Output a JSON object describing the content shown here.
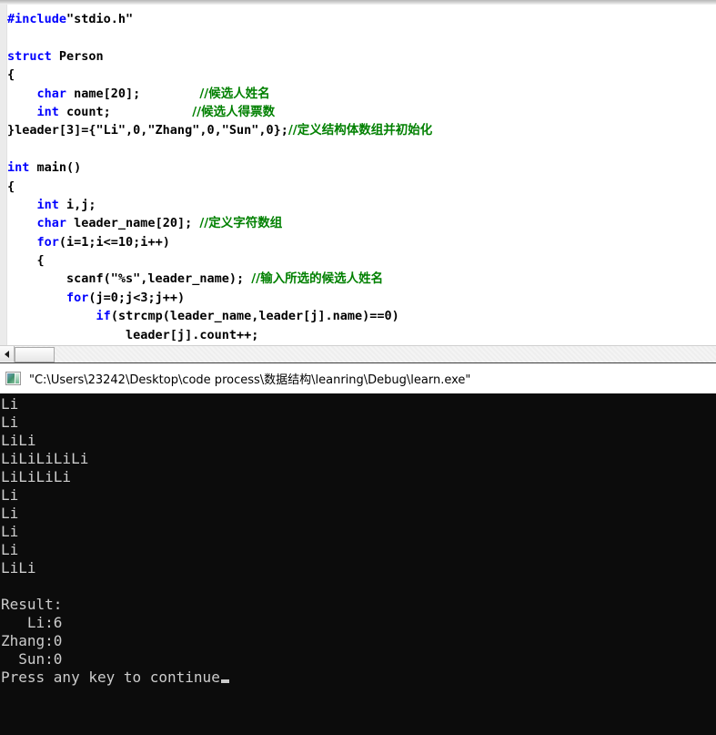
{
  "editor": {
    "name": "source-code-editor",
    "language": "C",
    "code_lines": [
      {
        "id": "l1",
        "segments": [
          {
            "t": "#include",
            "c": "pp"
          },
          {
            "t": "\"stdio.h\"",
            "c": "plain"
          }
        ]
      },
      {
        "id": "l2",
        "segments": []
      },
      {
        "id": "l3",
        "segments": [
          {
            "t": "struct",
            "c": "kw"
          },
          {
            "t": " Person",
            "c": "plain"
          }
        ]
      },
      {
        "id": "l4",
        "segments": [
          {
            "t": "{",
            "c": "plain"
          }
        ]
      },
      {
        "id": "l5",
        "segments": [
          {
            "t": "    ",
            "c": "plain"
          },
          {
            "t": "char",
            "c": "kw"
          },
          {
            "t": " name[20];        ",
            "c": "plain"
          },
          {
            "t": "//候选人姓名",
            "c": "cm"
          }
        ]
      },
      {
        "id": "l6",
        "segments": [
          {
            "t": "    ",
            "c": "plain"
          },
          {
            "t": "int",
            "c": "kw"
          },
          {
            "t": " count;           ",
            "c": "plain"
          },
          {
            "t": "//候选人得票数",
            "c": "cm"
          }
        ]
      },
      {
        "id": "l7",
        "segments": [
          {
            "t": "}leader[3]={\"Li\",0,\"Zhang\",0,\"Sun\",0};",
            "c": "plain"
          },
          {
            "t": "//定义结构体数组并初始化",
            "c": "cm"
          }
        ]
      },
      {
        "id": "l8",
        "segments": []
      },
      {
        "id": "l9",
        "segments": [
          {
            "t": "int",
            "c": "kw"
          },
          {
            "t": " main()",
            "c": "plain"
          }
        ]
      },
      {
        "id": "l10",
        "segments": [
          {
            "t": "{",
            "c": "plain"
          }
        ]
      },
      {
        "id": "l11",
        "segments": [
          {
            "t": "    ",
            "c": "plain"
          },
          {
            "t": "int",
            "c": "kw"
          },
          {
            "t": " i,j;",
            "c": "plain"
          }
        ]
      },
      {
        "id": "l12",
        "segments": [
          {
            "t": "    ",
            "c": "plain"
          },
          {
            "t": "char",
            "c": "kw"
          },
          {
            "t": " leader_name[20]; ",
            "c": "plain"
          },
          {
            "t": "//定义字符数组",
            "c": "cm"
          }
        ]
      },
      {
        "id": "l13",
        "segments": [
          {
            "t": "    ",
            "c": "plain"
          },
          {
            "t": "for",
            "c": "kw"
          },
          {
            "t": "(i=1;i<=10;i++)",
            "c": "plain"
          }
        ]
      },
      {
        "id": "l14",
        "segments": [
          {
            "t": "    {",
            "c": "plain"
          }
        ]
      },
      {
        "id": "l15",
        "segments": [
          {
            "t": "        scanf(\"%s\",leader_name); ",
            "c": "plain"
          },
          {
            "t": "//输入所选的候选人姓名",
            "c": "cm"
          }
        ]
      },
      {
        "id": "l16",
        "segments": [
          {
            "t": "        ",
            "c": "plain"
          },
          {
            "t": "for",
            "c": "kw"
          },
          {
            "t": "(j=0;j<3;j++)",
            "c": "plain"
          }
        ]
      },
      {
        "id": "l17",
        "segments": [
          {
            "t": "            ",
            "c": "plain"
          },
          {
            "t": "if",
            "c": "kw"
          },
          {
            "t": "(strcmp(leader_name,leader[j].name)==0)",
            "c": "plain"
          }
        ]
      },
      {
        "id": "l18",
        "segments": [
          {
            "t": "                leader[j].count++;",
            "c": "plain"
          }
        ]
      },
      {
        "id": "l19",
        "segments": []
      },
      {
        "id": "l20",
        "segments": [
          {
            "t": "    }",
            "c": "plain"
          }
        ]
      }
    ],
    "colors": {
      "keyword": "#0000ff",
      "comment": "#008000",
      "text": "#000000",
      "background": "#ffffff"
    }
  },
  "scrollbar": {
    "name": "horizontal-scrollbar",
    "left_arrow_glyph": "◀",
    "orientation": "horizontal"
  },
  "console": {
    "title": "\"C:\\Users\\23242\\Desktop\\code process\\数据结构\\leanring\\Debug\\learn.exe\"",
    "icon_name": "console-window-icon",
    "colors": {
      "background": "#0c0c0c",
      "foreground": "#cccccc",
      "titlebar": "#ffffff"
    },
    "output_lines": [
      "Li",
      "Li",
      "LiLi",
      "LiLiLiLiLi",
      "LiLiLiLi",
      "Li",
      "Li",
      "Li",
      "Li",
      "LiLi",
      "",
      "Result:",
      "   Li:6",
      "Zhang:0",
      "  Sun:0"
    ],
    "prompt_line": "Press any key to continue",
    "results": {
      "header": "Result:",
      "entries": [
        {
          "name": "Li",
          "votes": 6
        },
        {
          "name": "Zhang",
          "votes": 0
        },
        {
          "name": "Sun",
          "votes": 0
        }
      ]
    }
  }
}
